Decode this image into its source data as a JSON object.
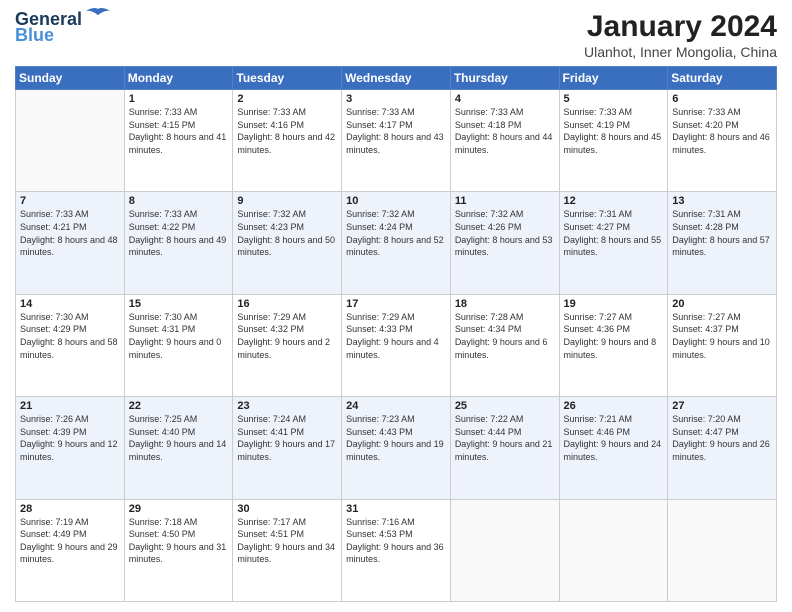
{
  "logo": {
    "line1": "General",
    "line2": "Blue"
  },
  "title": "January 2024",
  "subtitle": "Ulanhot, Inner Mongolia, China",
  "days_of_week": [
    "Sunday",
    "Monday",
    "Tuesday",
    "Wednesday",
    "Thursday",
    "Friday",
    "Saturday"
  ],
  "weeks": [
    [
      {
        "num": "",
        "sunrise": "",
        "sunset": "",
        "daylight": ""
      },
      {
        "num": "1",
        "sunrise": "Sunrise: 7:33 AM",
        "sunset": "Sunset: 4:15 PM",
        "daylight": "Daylight: 8 hours and 41 minutes."
      },
      {
        "num": "2",
        "sunrise": "Sunrise: 7:33 AM",
        "sunset": "Sunset: 4:16 PM",
        "daylight": "Daylight: 8 hours and 42 minutes."
      },
      {
        "num": "3",
        "sunrise": "Sunrise: 7:33 AM",
        "sunset": "Sunset: 4:17 PM",
        "daylight": "Daylight: 8 hours and 43 minutes."
      },
      {
        "num": "4",
        "sunrise": "Sunrise: 7:33 AM",
        "sunset": "Sunset: 4:18 PM",
        "daylight": "Daylight: 8 hours and 44 minutes."
      },
      {
        "num": "5",
        "sunrise": "Sunrise: 7:33 AM",
        "sunset": "Sunset: 4:19 PM",
        "daylight": "Daylight: 8 hours and 45 minutes."
      },
      {
        "num": "6",
        "sunrise": "Sunrise: 7:33 AM",
        "sunset": "Sunset: 4:20 PM",
        "daylight": "Daylight: 8 hours and 46 minutes."
      }
    ],
    [
      {
        "num": "7",
        "sunrise": "Sunrise: 7:33 AM",
        "sunset": "Sunset: 4:21 PM",
        "daylight": "Daylight: 8 hours and 48 minutes."
      },
      {
        "num": "8",
        "sunrise": "Sunrise: 7:33 AM",
        "sunset": "Sunset: 4:22 PM",
        "daylight": "Daylight: 8 hours and 49 minutes."
      },
      {
        "num": "9",
        "sunrise": "Sunrise: 7:32 AM",
        "sunset": "Sunset: 4:23 PM",
        "daylight": "Daylight: 8 hours and 50 minutes."
      },
      {
        "num": "10",
        "sunrise": "Sunrise: 7:32 AM",
        "sunset": "Sunset: 4:24 PM",
        "daylight": "Daylight: 8 hours and 52 minutes."
      },
      {
        "num": "11",
        "sunrise": "Sunrise: 7:32 AM",
        "sunset": "Sunset: 4:26 PM",
        "daylight": "Daylight: 8 hours and 53 minutes."
      },
      {
        "num": "12",
        "sunrise": "Sunrise: 7:31 AM",
        "sunset": "Sunset: 4:27 PM",
        "daylight": "Daylight: 8 hours and 55 minutes."
      },
      {
        "num": "13",
        "sunrise": "Sunrise: 7:31 AM",
        "sunset": "Sunset: 4:28 PM",
        "daylight": "Daylight: 8 hours and 57 minutes."
      }
    ],
    [
      {
        "num": "14",
        "sunrise": "Sunrise: 7:30 AM",
        "sunset": "Sunset: 4:29 PM",
        "daylight": "Daylight: 8 hours and 58 minutes."
      },
      {
        "num": "15",
        "sunrise": "Sunrise: 7:30 AM",
        "sunset": "Sunset: 4:31 PM",
        "daylight": "Daylight: 9 hours and 0 minutes."
      },
      {
        "num": "16",
        "sunrise": "Sunrise: 7:29 AM",
        "sunset": "Sunset: 4:32 PM",
        "daylight": "Daylight: 9 hours and 2 minutes."
      },
      {
        "num": "17",
        "sunrise": "Sunrise: 7:29 AM",
        "sunset": "Sunset: 4:33 PM",
        "daylight": "Daylight: 9 hours and 4 minutes."
      },
      {
        "num": "18",
        "sunrise": "Sunrise: 7:28 AM",
        "sunset": "Sunset: 4:34 PM",
        "daylight": "Daylight: 9 hours and 6 minutes."
      },
      {
        "num": "19",
        "sunrise": "Sunrise: 7:27 AM",
        "sunset": "Sunset: 4:36 PM",
        "daylight": "Daylight: 9 hours and 8 minutes."
      },
      {
        "num": "20",
        "sunrise": "Sunrise: 7:27 AM",
        "sunset": "Sunset: 4:37 PM",
        "daylight": "Daylight: 9 hours and 10 minutes."
      }
    ],
    [
      {
        "num": "21",
        "sunrise": "Sunrise: 7:26 AM",
        "sunset": "Sunset: 4:39 PM",
        "daylight": "Daylight: 9 hours and 12 minutes."
      },
      {
        "num": "22",
        "sunrise": "Sunrise: 7:25 AM",
        "sunset": "Sunset: 4:40 PM",
        "daylight": "Daylight: 9 hours and 14 minutes."
      },
      {
        "num": "23",
        "sunrise": "Sunrise: 7:24 AM",
        "sunset": "Sunset: 4:41 PM",
        "daylight": "Daylight: 9 hours and 17 minutes."
      },
      {
        "num": "24",
        "sunrise": "Sunrise: 7:23 AM",
        "sunset": "Sunset: 4:43 PM",
        "daylight": "Daylight: 9 hours and 19 minutes."
      },
      {
        "num": "25",
        "sunrise": "Sunrise: 7:22 AM",
        "sunset": "Sunset: 4:44 PM",
        "daylight": "Daylight: 9 hours and 21 minutes."
      },
      {
        "num": "26",
        "sunrise": "Sunrise: 7:21 AM",
        "sunset": "Sunset: 4:46 PM",
        "daylight": "Daylight: 9 hours and 24 minutes."
      },
      {
        "num": "27",
        "sunrise": "Sunrise: 7:20 AM",
        "sunset": "Sunset: 4:47 PM",
        "daylight": "Daylight: 9 hours and 26 minutes."
      }
    ],
    [
      {
        "num": "28",
        "sunrise": "Sunrise: 7:19 AM",
        "sunset": "Sunset: 4:49 PM",
        "daylight": "Daylight: 9 hours and 29 minutes."
      },
      {
        "num": "29",
        "sunrise": "Sunrise: 7:18 AM",
        "sunset": "Sunset: 4:50 PM",
        "daylight": "Daylight: 9 hours and 31 minutes."
      },
      {
        "num": "30",
        "sunrise": "Sunrise: 7:17 AM",
        "sunset": "Sunset: 4:51 PM",
        "daylight": "Daylight: 9 hours and 34 minutes."
      },
      {
        "num": "31",
        "sunrise": "Sunrise: 7:16 AM",
        "sunset": "Sunset: 4:53 PM",
        "daylight": "Daylight: 9 hours and 36 minutes."
      },
      {
        "num": "",
        "sunrise": "",
        "sunset": "",
        "daylight": ""
      },
      {
        "num": "",
        "sunrise": "",
        "sunset": "",
        "daylight": ""
      },
      {
        "num": "",
        "sunrise": "",
        "sunset": "",
        "daylight": ""
      }
    ]
  ]
}
